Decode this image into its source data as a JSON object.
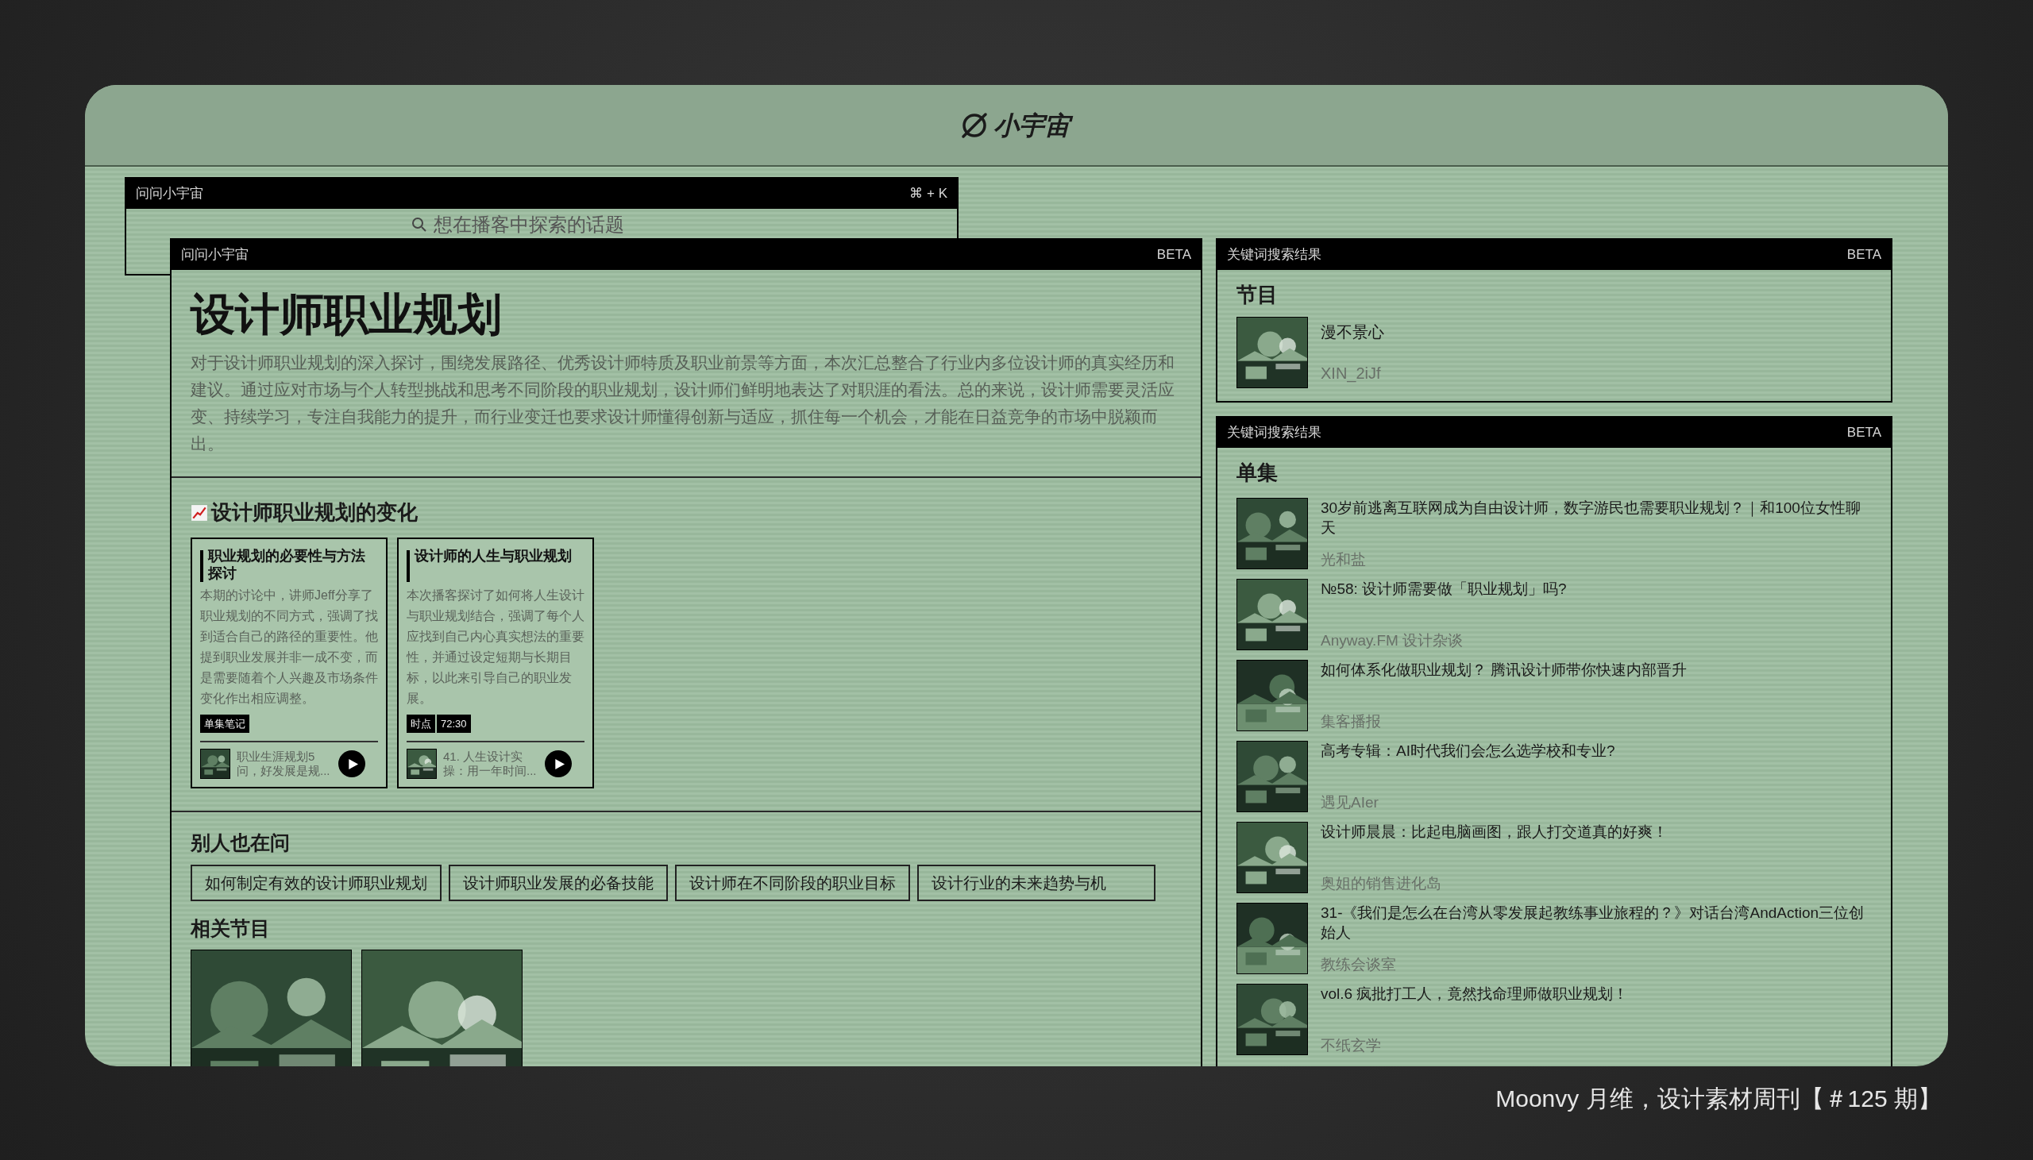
{
  "app": {
    "logo": "小宇宙"
  },
  "back_window": {
    "title": "问问小宇宙",
    "shortcut": "⌘ + K",
    "search": {
      "placeholder": "想在播客中探索的话题"
    }
  },
  "main_window": {
    "title": "问问小宇宙",
    "badge": "BETA",
    "heading": "设计师职业规划",
    "summary": "对于设计师职业规划的深入探讨，围绕发展路径、优秀设计师特质及职业前景等方面，本次汇总整合了行业内多位设计师的真实经历和建议。通过应对市场与个人转型挑战和思考不同阶段的职业规划，设计师们鲜明地表达了对职涯的看法。总的来说，设计师需要灵活应变、持续学习，专注自我能力的提升，而行业变迁也要求设计师懂得创新与适应，抓住每一个机会，才能在日益竞争的市场中脱颖而出。",
    "section_title": "设计师职业规划的变化",
    "cards": [
      {
        "title": "职业规划的必要性与方法探讨",
        "description": "本期的讨论中，讲师Jeff分享了职业规划的不同方式，强调了找到适合自己的路径的重要性。他提到职业发展并非一成不变，而是需要随着个人兴趣及市场条件变化作出相应调整。",
        "tags": [
          "单集笔记"
        ],
        "episode": "职业生涯规划5问，好发展是规..."
      },
      {
        "title": "设计师的人生与职业规划",
        "description": "本次播客探讨了如何将人生设计与职业规划结合，强调了每个人应找到自己内心真实想法的重要性，并通过设定短期与长期目标，以此来引导自己的职业发展。",
        "tags": [
          "时点",
          "72:30"
        ],
        "episode": "41. 人生设计实操：用一年时间..."
      }
    ],
    "others_ask": {
      "title": "别人也在问",
      "questions": [
        "如何制定有效的设计师职业规划",
        "设计师职业发展的必备技能",
        "设计师在不同阶段的职业目标",
        "设计行业的未来趋势与机"
      ]
    },
    "related": {
      "title": "相关节目"
    }
  },
  "program_results": {
    "title": "关键词搜索结果",
    "badge": "BETA",
    "heading": "节目",
    "items": [
      {
        "title": "漫不景心",
        "author": "XIN_2iJf"
      }
    ]
  },
  "episode_results": {
    "title": "关键词搜索结果",
    "badge": "BETA",
    "heading": "单集",
    "items": [
      {
        "title": "30岁前逃离互联网成为自由设计师，数字游民也需要职业规划？｜和100位女性聊天",
        "podcast": "光和盐"
      },
      {
        "title": "№58: 设计师需要做「职业规划」吗?",
        "podcast": "Anyway.FM 设计杂谈"
      },
      {
        "title": "如何体系化做职业规划？ 腾讯设计师带你快速内部晋升",
        "podcast": "集客播报"
      },
      {
        "title": "高考专辑：AI时代我们会怎么选学校和专业?",
        "podcast": "遇见AIer"
      },
      {
        "title": "设计师晨晨：比起电脑画图，跟人打交道真的好爽！",
        "podcast": "奥姐的销售进化岛"
      },
      {
        "title": "31-《我们是怎么在台湾从零发展起教练事业旅程的？》对话台湾AndAction三位创始人",
        "podcast": "教练会谈室"
      },
      {
        "title": "vol.6 疯批打工人，竟然找命理师做职业规划！",
        "podcast": "不纸玄学"
      }
    ]
  },
  "footer": "Moonvy 月维，设计素材周刊【＃125 期】"
}
